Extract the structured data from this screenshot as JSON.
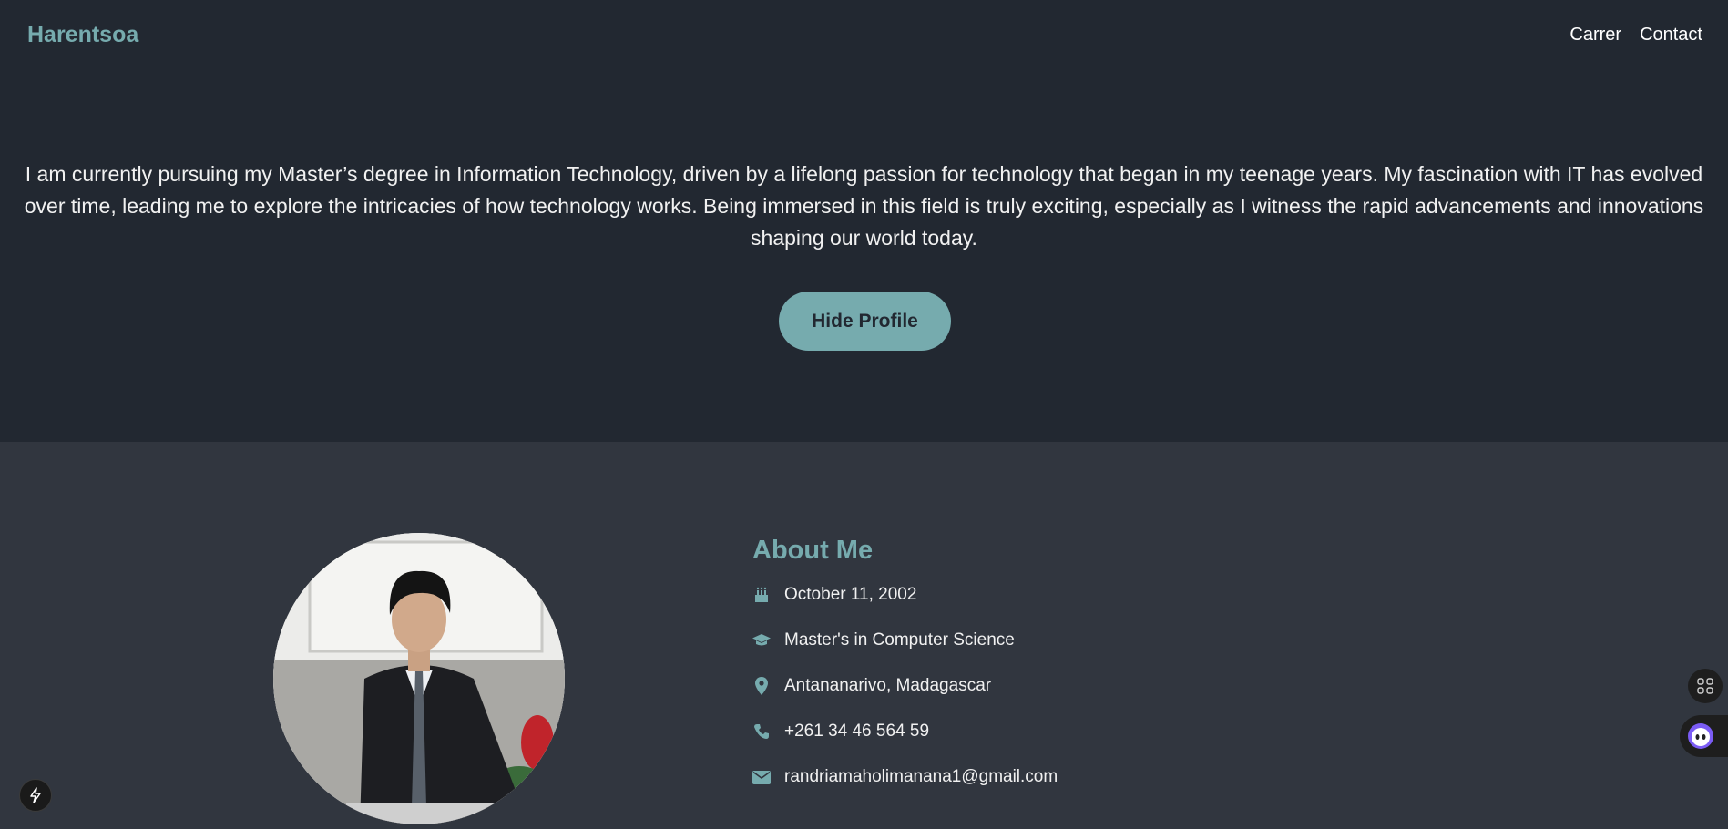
{
  "nav": {
    "brand": "Harentsoa",
    "links": [
      "Carrer",
      "Contact"
    ]
  },
  "intro": {
    "text": "I am currently pursuing my Master’s degree in Information Technology, driven by a lifelong passion for technology that began in my teenage years. My fascination with IT has evolved over time, leading me to explore the intricacies of how technology works. Being immersed in this field is truly exciting, especially as I witness the rapid advancements and innovations shaping our world today.",
    "button_label": "Hide Profile"
  },
  "about": {
    "title": "About Me",
    "items": [
      {
        "icon": "birthday-cake-icon",
        "text": "October 11, 2002"
      },
      {
        "icon": "graduation-cap-icon",
        "text": "Master's in Computer Science"
      },
      {
        "icon": "map-marker-icon",
        "text": "Antananarivo, Madagascar"
      },
      {
        "icon": "phone-icon",
        "text": "+261 34 46 564 59"
      },
      {
        "icon": "envelope-icon",
        "text": "randriamaholimanana1@gmail.com"
      }
    ]
  },
  "colors": {
    "accent": "#76abae",
    "dark_bg": "#222831",
    "section_bg": "#31363f",
    "text": "#ffffff"
  }
}
